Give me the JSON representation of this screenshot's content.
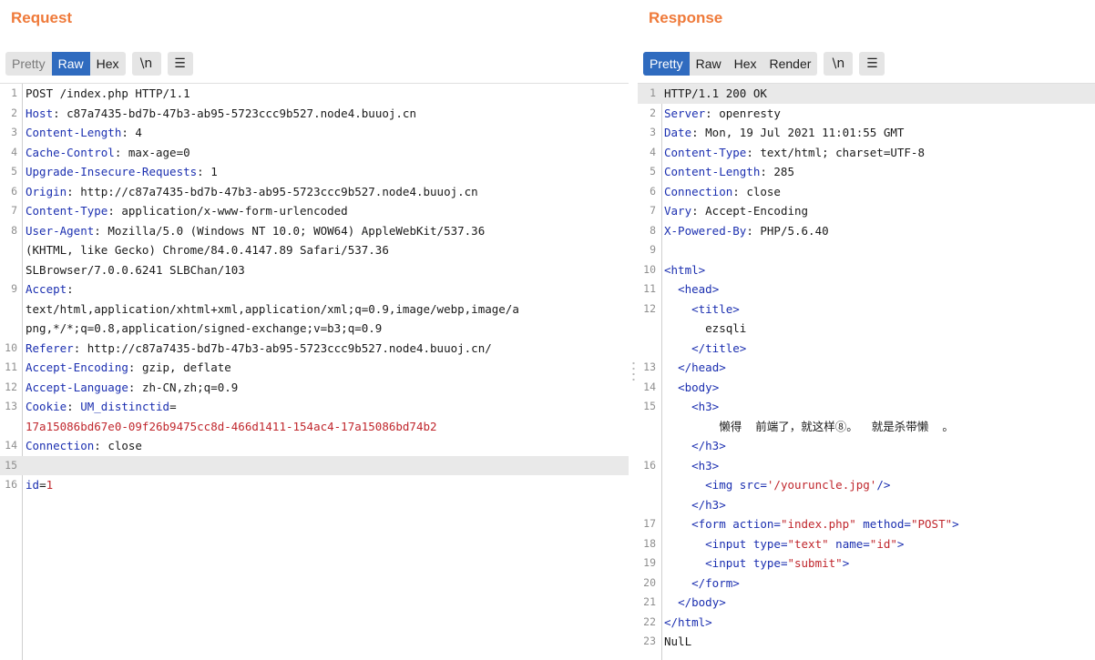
{
  "request": {
    "title": "Request",
    "tabs": [
      "Pretty",
      "Raw",
      "Hex"
    ],
    "newline_label": "\\n",
    "menu_icon": "hamburger-icon",
    "lines": [
      {
        "n": "1",
        "k": "",
        "v": "POST /index.php HTTP/1.1"
      },
      {
        "n": "2",
        "k": "Host",
        "v": ": c87a7435-bd7b-47b3-ab95-5723ccc9b527.node4.buuoj.cn"
      },
      {
        "n": "3",
        "k": "Content-Length",
        "v": ": 4"
      },
      {
        "n": "4",
        "k": "Cache-Control",
        "v": ": max-age=0"
      },
      {
        "n": "5",
        "k": "Upgrade-Insecure-Requests",
        "v": ": 1"
      },
      {
        "n": "6",
        "k": "Origin",
        "v": ": http://c87a7435-bd7b-47b3-ab95-5723ccc9b527.node4.buuoj.cn"
      },
      {
        "n": "7",
        "k": "Content-Type",
        "v": ": application/x-www-form-urlencoded"
      },
      {
        "n": "8",
        "k": "User-Agent",
        "v": ": Mozilla/5.0 (Windows NT 10.0; WOW64) AppleWebKit/537.36"
      },
      {
        "n": "",
        "k": "",
        "v": "(KHTML, like Gecko) Chrome/84.0.4147.89 Safari/537.36"
      },
      {
        "n": "",
        "k": "",
        "v": "SLBrowser/7.0.0.6241 SLBChan/103"
      },
      {
        "n": "9",
        "k": "Accept",
        "v": ":"
      },
      {
        "n": "",
        "k": "",
        "v": "text/html,application/xhtml+xml,application/xml;q=0.9,image/webp,image/a"
      },
      {
        "n": "",
        "k": "",
        "v": "png,*/*;q=0.8,application/signed-exchange;v=b3;q=0.9"
      },
      {
        "n": "10",
        "k": "Referer",
        "v": ": http://c87a7435-bd7b-47b3-ab95-5723ccc9b527.node4.buuoj.cn/"
      },
      {
        "n": "11",
        "k": "Accept-Encoding",
        "v": ": gzip, deflate"
      },
      {
        "n": "12",
        "k": "Accept-Language",
        "v": ": zh-CN,zh;q=0.9"
      },
      {
        "n": "13",
        "k": "Cookie",
        "v": ": ",
        "k2": "UM_distinctid",
        "v2": "="
      },
      {
        "n": "",
        "k": "",
        "v": "",
        "r": "17a15086bd67e0-09f26b9475cc8d-466d1411-154ac4-17a15086bd74b2"
      },
      {
        "n": "14",
        "k": "Connection",
        "v": ": close"
      },
      {
        "n": "15",
        "k": "",
        "v": "",
        "hl": true
      },
      {
        "n": "16",
        "k": "id",
        "v": "=",
        "r": "1"
      }
    ]
  },
  "response": {
    "title": "Response",
    "tabs": [
      "Pretty",
      "Raw",
      "Hex",
      "Render"
    ],
    "newline_label": "\\n",
    "menu_icon": "hamburger-icon",
    "lines": [
      {
        "n": "1",
        "k": "",
        "v": "HTTP/1.1 200 OK",
        "hl": true
      },
      {
        "n": "2",
        "k": "Server",
        "v": ": openresty"
      },
      {
        "n": "3",
        "k": "Date",
        "v": ": Mon, 19 Jul 2021 11:01:55 GMT"
      },
      {
        "n": "4",
        "k": "Content-Type",
        "v": ": text/html; charset=UTF-8"
      },
      {
        "n": "5",
        "k": "Content-Length",
        "v": ": 285"
      },
      {
        "n": "6",
        "k": "Connection",
        "v": ": close"
      },
      {
        "n": "7",
        "k": "Vary",
        "v": ": Accept-Encoding"
      },
      {
        "n": "8",
        "k": "X-Powered-By",
        "v": ": PHP/5.6.40"
      },
      {
        "n": "9",
        "k": "",
        "v": ""
      },
      {
        "n": "10",
        "html": [
          [
            "t",
            "<html>"
          ]
        ]
      },
      {
        "n": "11",
        "html": [
          [
            "p",
            "  "
          ],
          [
            "t",
            "<head>"
          ]
        ]
      },
      {
        "n": "12",
        "html": [
          [
            "p",
            "    "
          ],
          [
            "t",
            "<title>"
          ]
        ]
      },
      {
        "n": "",
        "html": [
          [
            "p",
            "      ezsqli"
          ]
        ]
      },
      {
        "n": "",
        "html": [
          [
            "p",
            "    "
          ],
          [
            "t",
            "</title>"
          ]
        ]
      },
      {
        "n": "13",
        "html": [
          [
            "p",
            "  "
          ],
          [
            "t",
            "</head>"
          ]
        ]
      },
      {
        "n": "14",
        "html": [
          [
            "p",
            "  "
          ],
          [
            "t",
            "<body>"
          ]
        ]
      },
      {
        "n": "15",
        "html": [
          [
            "p",
            "    "
          ],
          [
            "t",
            "<h3>"
          ]
        ]
      },
      {
        "n": "",
        "html": [
          [
            "p",
            "        懒得  前端了，就这样⑧。  就是杀带懒  。"
          ]
        ]
      },
      {
        "n": "",
        "html": [
          [
            "p",
            "    "
          ],
          [
            "t",
            "</h3>"
          ]
        ]
      },
      {
        "n": "16",
        "html": [
          [
            "p",
            "    "
          ],
          [
            "t",
            "<h3>"
          ]
        ]
      },
      {
        "n": "",
        "html": [
          [
            "p",
            "      "
          ],
          [
            "t",
            "<img "
          ],
          [
            "a",
            "src="
          ],
          [
            "s",
            "'/youruncle.jpg'"
          ],
          [
            "t",
            "/>"
          ]
        ]
      },
      {
        "n": "",
        "html": [
          [
            "p",
            "    "
          ],
          [
            "t",
            "</h3>"
          ]
        ]
      },
      {
        "n": "17",
        "html": [
          [
            "p",
            "    "
          ],
          [
            "t",
            "<form "
          ],
          [
            "a",
            "action="
          ],
          [
            "s",
            "\"index.php\""
          ],
          [
            "a",
            " method="
          ],
          [
            "s",
            "\"POST\""
          ],
          [
            "t",
            ">"
          ]
        ]
      },
      {
        "n": "18",
        "html": [
          [
            "p",
            "      "
          ],
          [
            "t",
            "<input "
          ],
          [
            "a",
            "type="
          ],
          [
            "s",
            "\"text\""
          ],
          [
            "a",
            " name="
          ],
          [
            "s",
            "\"id\""
          ],
          [
            "t",
            ">"
          ]
        ]
      },
      {
        "n": "19",
        "html": [
          [
            "p",
            "      "
          ],
          [
            "t",
            "<input "
          ],
          [
            "a",
            "type="
          ],
          [
            "s",
            "\"submit\""
          ],
          [
            "t",
            ">"
          ]
        ]
      },
      {
        "n": "20",
        "html": [
          [
            "p",
            "    "
          ],
          [
            "t",
            "</form>"
          ]
        ]
      },
      {
        "n": "21",
        "html": [
          [
            "p",
            "  "
          ],
          [
            "t",
            "</body>"
          ]
        ]
      },
      {
        "n": "22",
        "html": [
          [
            "t",
            "</html>"
          ]
        ]
      },
      {
        "n": "23",
        "html": [
          [
            "p",
            "NulL"
          ]
        ]
      }
    ]
  }
}
